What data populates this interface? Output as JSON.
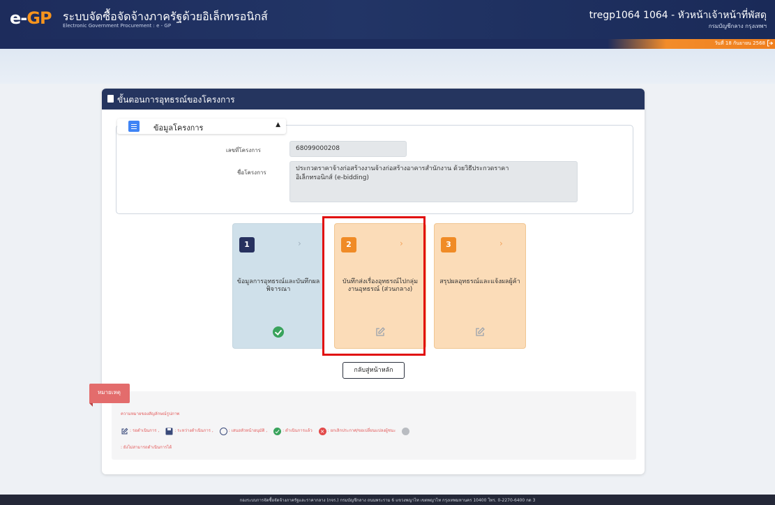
{
  "header": {
    "logo_e": "e-",
    "logo_gp": "GP",
    "title": "ระบบจัดซื้อจัดจ้างภาครัฐด้วยอิเล็กทรอนิกส์",
    "subtitle": "Electronic Government Procurement : e - GP",
    "user": "tregp1064 1064 - หัวหน้าเจ้าหน้าที่พัสดุ",
    "department": "กรมบัญชีกลาง กรุงเทพฯ",
    "date": "วันที่ 18 กันยายน 2568"
  },
  "card": {
    "title": "ขั้นตอนการอุทธรณ์ของโครงการ",
    "section_label": "ข้อมูลโครงการ",
    "project_no_label": "เลขที่โครงการ",
    "project_no": "68099000208",
    "project_name_label": "ชื่อโครงการ",
    "project_name": "ประกวดราคาจ้างก่อสร้างงานจ้างก่อสร้างอาคารสำนักงาน ด้วยวิธีประกวดราคาอิเล็กทรอนิกส์ (e-bidding)"
  },
  "steps": [
    {
      "number": "1",
      "label": "ข้อมูลการอุทธรณ์และบันทึกผลพิจารณา",
      "status": "completed",
      "status_icon": "check-icon"
    },
    {
      "number": "2",
      "label": "บันทึกส่งเรื่องอุทธรณ์ไปกลุ่มงานอุทธรณ์ (ส่วนกลาง)",
      "status": "pending",
      "status_icon": "edit-icon"
    },
    {
      "number": "3",
      "label": "สรุปผลอุทธรณ์และแจ้งผลผู้ค้า",
      "status": "pending",
      "status_icon": "edit-icon"
    }
  ],
  "back_button": "กลับสู่หน้าหลัก",
  "notes": {
    "badge": "หมายเหตุ",
    "heading": "ความหมายของสัญลักษณ์รูปภาพ",
    "legend": [
      {
        "icon": "edit-icon",
        "text": ": รอดำเนินการ ,"
      },
      {
        "icon": "save-icon",
        "text": ": ระหว่างดำเนินการ ,"
      },
      {
        "icon": "person-icon",
        "text": ": เสนอหัวหน้าอนุมัติ ,"
      },
      {
        "icon": "check-icon",
        "text": ": ดำเนินการแล้ว"
      },
      {
        "icon": "cancel-icon",
        "text": ": ยกเลิกประกาศ/ขอเปลี่ยนแปลงผู้ชนะ"
      },
      {
        "icon": "disabled-icon",
        "text": ": ยังไม่สามารถดำเนินการได้"
      }
    ]
  },
  "footer": "กองระบบการจัดซื้อจัดจ้างภาครัฐและราคากลาง (กจร.) กรมบัญชีกลาง ถนนพระราม 6 แขวงพญาไท เขตพญาไท กรุงเทพมหานคร 10400 โทร. 0-2270-6400 กด 3",
  "colors": {
    "header_bg": "#1d2c5c",
    "accent_orange": "#f08b26",
    "step_done_bg": "#cfe0ea",
    "step_pending_bg": "#fbdcb8",
    "highlight_red": "#e10d0d",
    "success_green": "#39a35c"
  }
}
